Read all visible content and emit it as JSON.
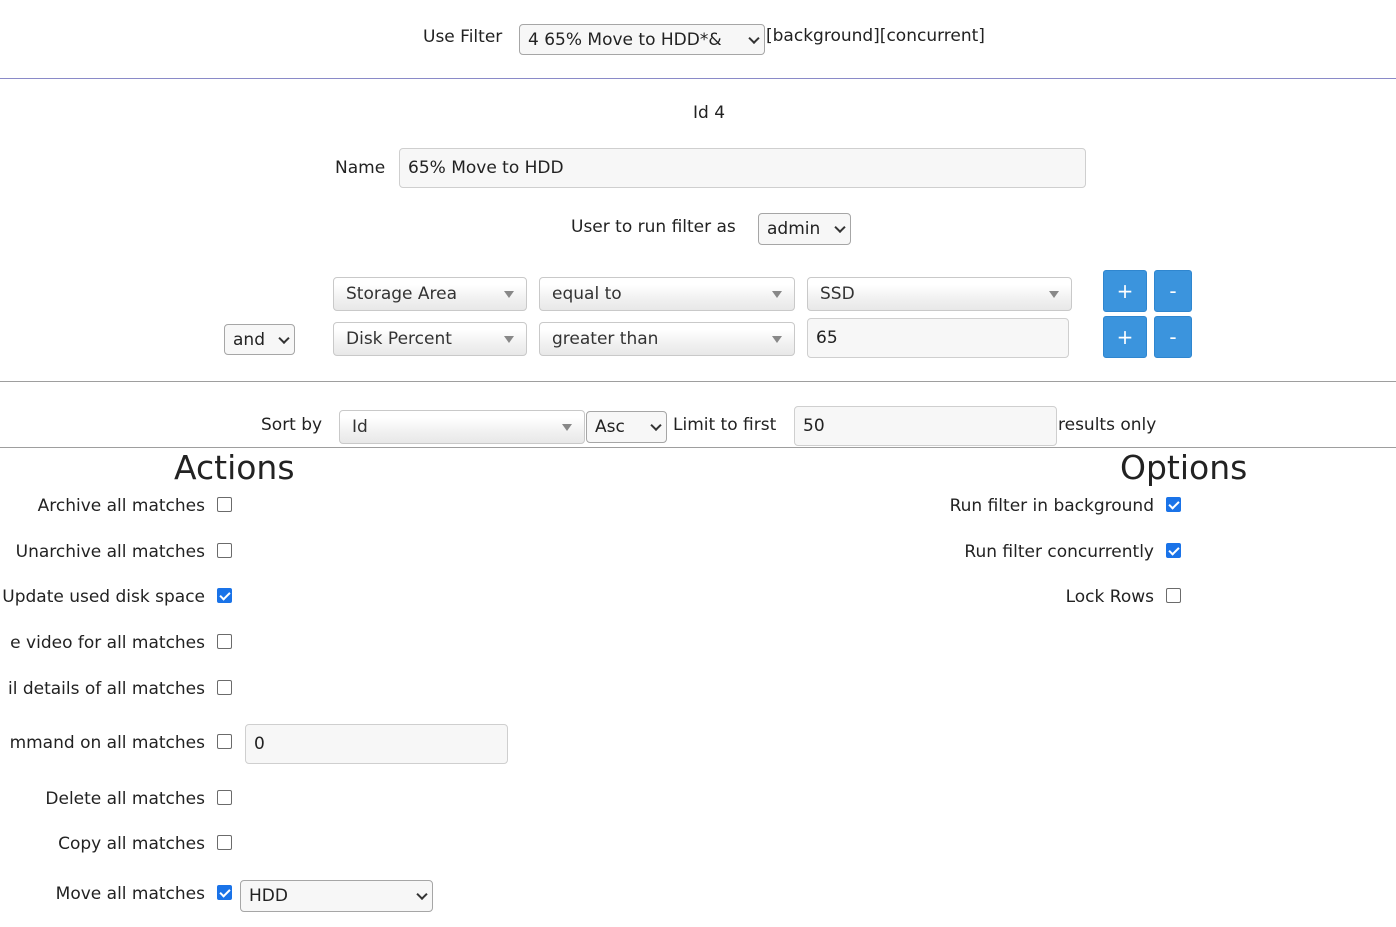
{
  "top": {
    "use_filter_label": "Use Filter",
    "selected_filter": "4 65% Move to HDD*&",
    "flags_text": "[background][concurrent]"
  },
  "filter": {
    "id_text": "Id 4",
    "name_label": "Name",
    "name_value": "65% Move to HDD",
    "user_label": "User to run filter as",
    "user_value": "admin"
  },
  "conditions": [
    {
      "field": "Storage Area",
      "operator": "equal to",
      "value": "SSD",
      "add": "+",
      "remove": "-"
    },
    {
      "connector": "and",
      "field": "Disk Percent",
      "operator": "greater than",
      "value": "65",
      "add": "+",
      "remove": "-"
    }
  ],
  "sort": {
    "label": "Sort by",
    "field": "Id",
    "direction": "Asc",
    "limit_label": "Limit to first",
    "limit_value": "50",
    "suffix": "results only"
  },
  "actions": {
    "title": "Actions",
    "items": [
      {
        "label": "Archive all matches",
        "checked": false
      },
      {
        "label": "Unarchive all matches",
        "checked": false
      },
      {
        "label": "Update used disk space",
        "checked": true
      },
      {
        "label": "e video for all matches",
        "checked": false
      },
      {
        "label": "il details of all matches",
        "checked": false
      },
      {
        "label": "mmand on all matches",
        "checked": false,
        "input_value": "0"
      },
      {
        "label": "Delete all matches",
        "checked": false
      },
      {
        "label": "Copy all matches",
        "checked": false
      },
      {
        "label": "Move all matches",
        "checked": true,
        "select_value": "HDD"
      }
    ]
  },
  "options": {
    "title": "Options",
    "items": [
      {
        "label": "Run filter in background",
        "checked": true
      },
      {
        "label": "Run filter concurrently",
        "checked": true
      },
      {
        "label": "Lock Rows",
        "checked": false
      }
    ]
  },
  "colors": {
    "button_blue": "#3b94dd",
    "checkbox_blue": "#1a73e8",
    "divider_top": "#8a8ac8",
    "divider": "#9e9e9e"
  }
}
